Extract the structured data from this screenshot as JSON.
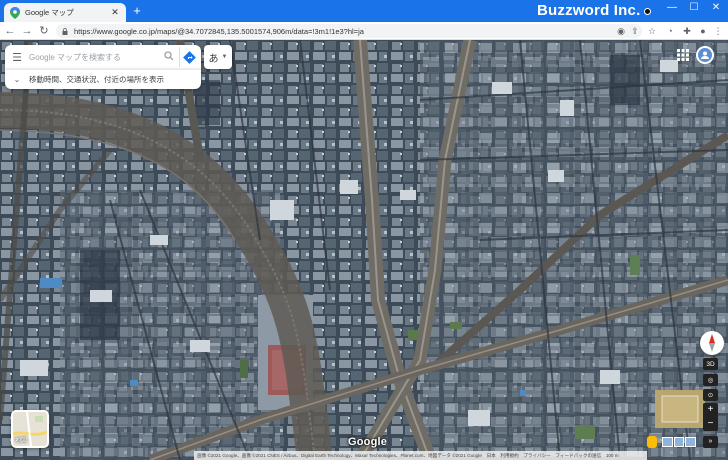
{
  "browser": {
    "tab_title": "Google マップ",
    "new_tab": "+",
    "close_tab": "✕",
    "url": "https://www.google.co.jp/maps/@34.7072845,135.5001574,906m/data=!3m1!1e3?hl=ja",
    "watermark": "Buzzword Inc.",
    "win_min": "—",
    "win_max": "☐",
    "win_close": "✕",
    "nav_back": "←",
    "nav_forward": "→",
    "nav_reload": "↻",
    "accent": "#1a73e8"
  },
  "maps": {
    "search_placeholder": "Google マップを検索する",
    "explore_text": "移動時間、交通状況、付近の場所を表示",
    "lang_button": "あ",
    "control_3d": "3D",
    "zoom_in": "+",
    "zoom_out": "−",
    "layers_label": "地図",
    "logo": "Google",
    "attribution": "画像 ©2021 Google、画像 ©2021 CNES / Airbus、Digital Earth Technology、Maxar Technologies、Planet.com、地図データ ©2021 Google　日本　利用規約　プライバシー　フィードバックの送信　100 m",
    "expand": "»"
  }
}
